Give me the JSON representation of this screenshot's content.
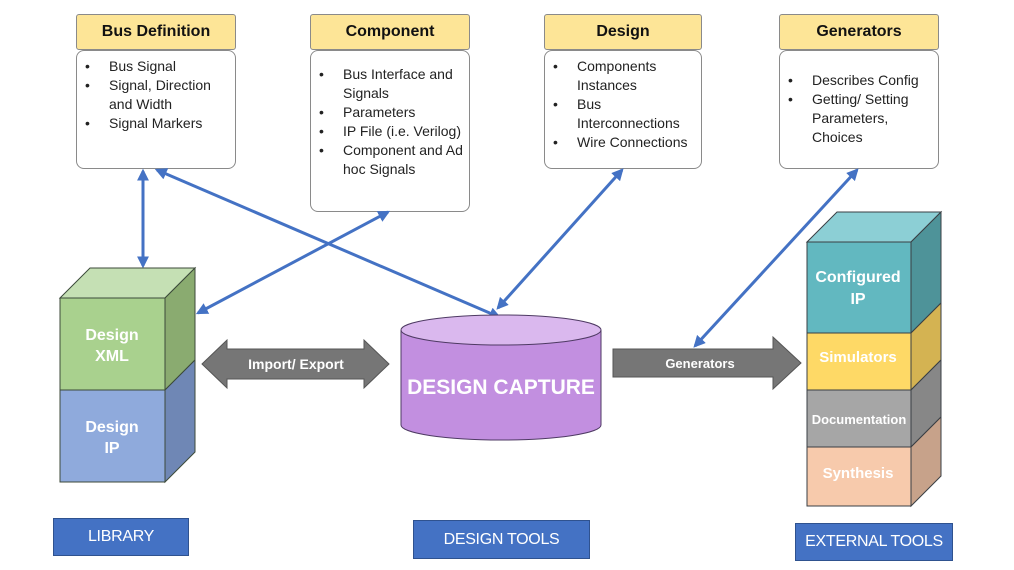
{
  "cards": [
    {
      "id": "bus-definition",
      "title": "Bus Definition",
      "items": [
        "Bus Signal",
        "Signal, Direction and Width",
        "Signal Markers"
      ]
    },
    {
      "id": "component",
      "title": "Component",
      "items": [
        "Bus Interface and Signals",
        "Parameters",
        "IP File (i.e. Verilog)",
        "Component and Ad hoc Signals"
      ]
    },
    {
      "id": "design",
      "title": "Design",
      "items": [
        "Components Instances",
        "Bus Interconnections",
        "Wire Connections"
      ]
    },
    {
      "id": "generators",
      "title": "Generators",
      "items": [
        "Describes Config",
        "Getting/ Setting Parameters, Choices"
      ]
    }
  ],
  "library_stack": {
    "blocks": [
      {
        "line1": "Design",
        "line2": "XML",
        "color": "#a9d18e"
      },
      {
        "line1": "Design",
        "line2": "IP",
        "color": "#8faadc"
      }
    ]
  },
  "design_capture": {
    "label": "DESIGN CAPTURE",
    "color": "#c28fe0"
  },
  "import_export_arrow": {
    "label": "Import/ Export"
  },
  "generators_arrow": {
    "label": "Generators"
  },
  "external_stack": {
    "blocks": [
      {
        "line1": "Configured",
        "line2": "IP",
        "color": "#62b8c0"
      },
      {
        "line1": "Simulators",
        "line2": "",
        "color": "#fed966"
      },
      {
        "line1": "Documentation",
        "line2": "",
        "color": "#a6a6a6"
      },
      {
        "line1": "Synthesis",
        "line2": "",
        "color": "#f7caac"
      }
    ]
  },
  "section_labels": {
    "library": "LIBRARY",
    "design_tools": "DESIGN TOOLS",
    "external_tools": "EXTERNAL TOOLS"
  },
  "colors": {
    "connector": "#4472c4",
    "card_header": "#fde597",
    "block_arrow": "#767676",
    "label_box": "#4472c4"
  }
}
